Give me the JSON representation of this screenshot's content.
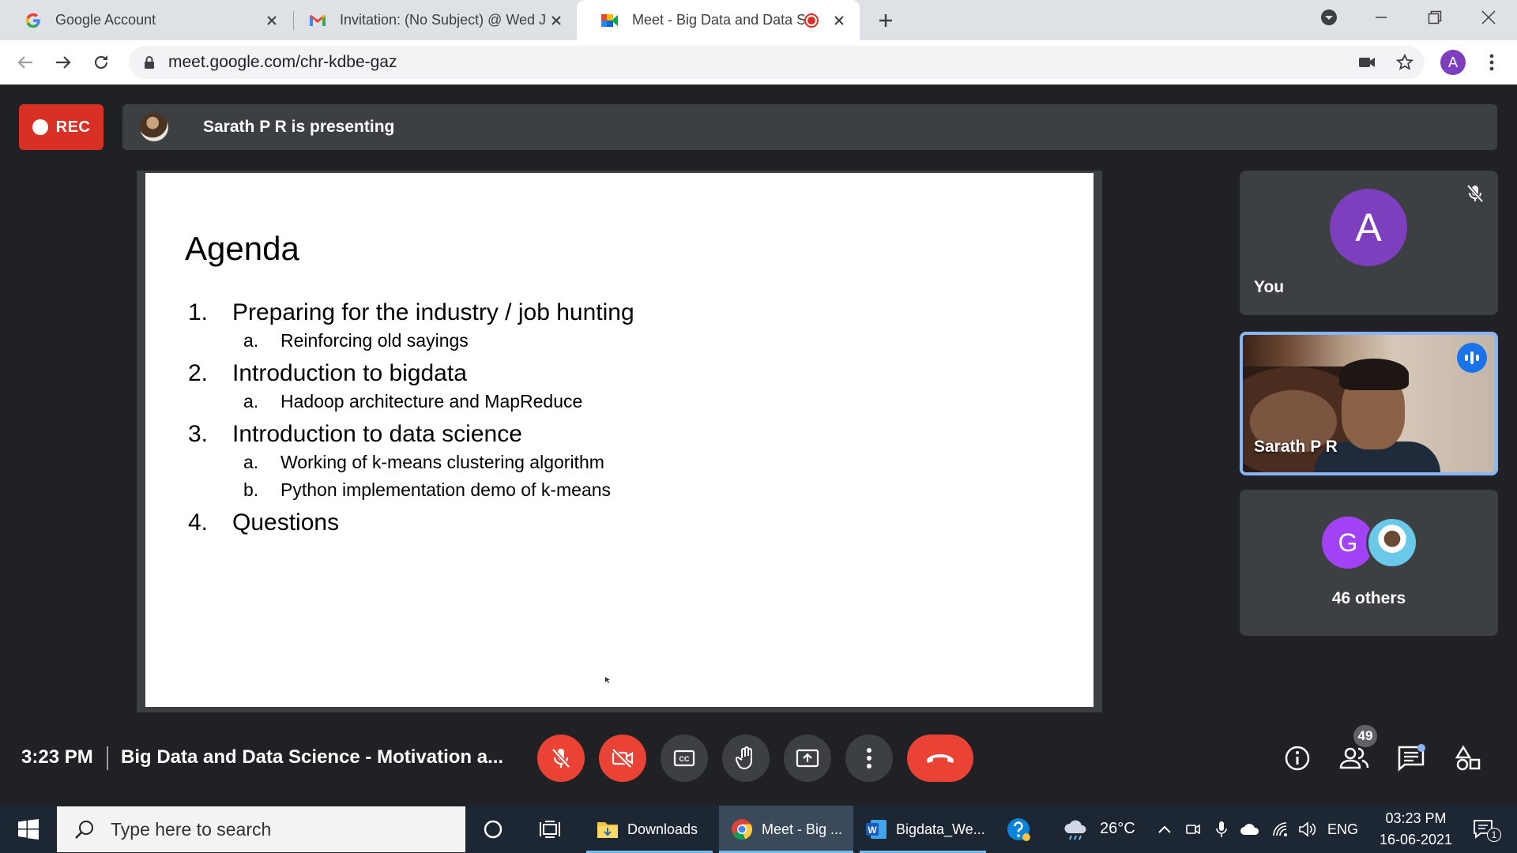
{
  "browser": {
    "tabs": [
      {
        "title": "Google Account"
      },
      {
        "title": "Invitation: (No Subject) @ Wed Ju"
      },
      {
        "title": "Meet - Big Data and Data Sc"
      }
    ],
    "url": "meet.google.com/chr-kdbe-gaz",
    "profile_initial": "A"
  },
  "meet": {
    "rec_label": "REC",
    "presenting_text": "Sarath P R is presenting",
    "slide": {
      "title": "Agenda",
      "items": [
        {
          "num": "1.",
          "text": "Preparing for the industry / job hunting",
          "subs": [
            {
              "num": "a.",
              "text": "Reinforcing old sayings"
            }
          ]
        },
        {
          "num": "2.",
          "text": "Introduction to bigdata",
          "subs": [
            {
              "num": "a.",
              "text": "Hadoop architecture and MapReduce"
            }
          ]
        },
        {
          "num": "3.",
          "text": "Introduction to data science",
          "subs": [
            {
              "num": "a.",
              "text": "Working of k-means clustering algorithm"
            },
            {
              "num": "b.",
              "text": "Python implementation demo of k-means"
            }
          ]
        },
        {
          "num": "4.",
          "text": "Questions",
          "subs": []
        }
      ]
    },
    "tiles": {
      "you": {
        "initial": "A",
        "name": "You"
      },
      "presenter": {
        "name": "Sarath P R"
      },
      "others": {
        "initial": "G",
        "label": "46 others"
      }
    },
    "bottom": {
      "time": "3:23 PM",
      "title": "Big Data and Data Science - Motivation a...",
      "participant_count": "49"
    }
  },
  "taskbar": {
    "search_placeholder": "Type here to search",
    "apps": [
      {
        "label": "Downloads"
      },
      {
        "label": "Meet - Big ..."
      },
      {
        "label": "Bigdata_We..."
      }
    ],
    "weather": "26°C",
    "language": "ENG",
    "clock_time": "03:23 PM",
    "clock_date": "16-06-2021",
    "notification_count": "1"
  },
  "colors": {
    "meet_bg": "#202124",
    "tile_bg": "#3c4043",
    "red": "#ea4335",
    "accent_blue": "#8ab4f8",
    "avatar_purple": "#7e3fbf"
  }
}
